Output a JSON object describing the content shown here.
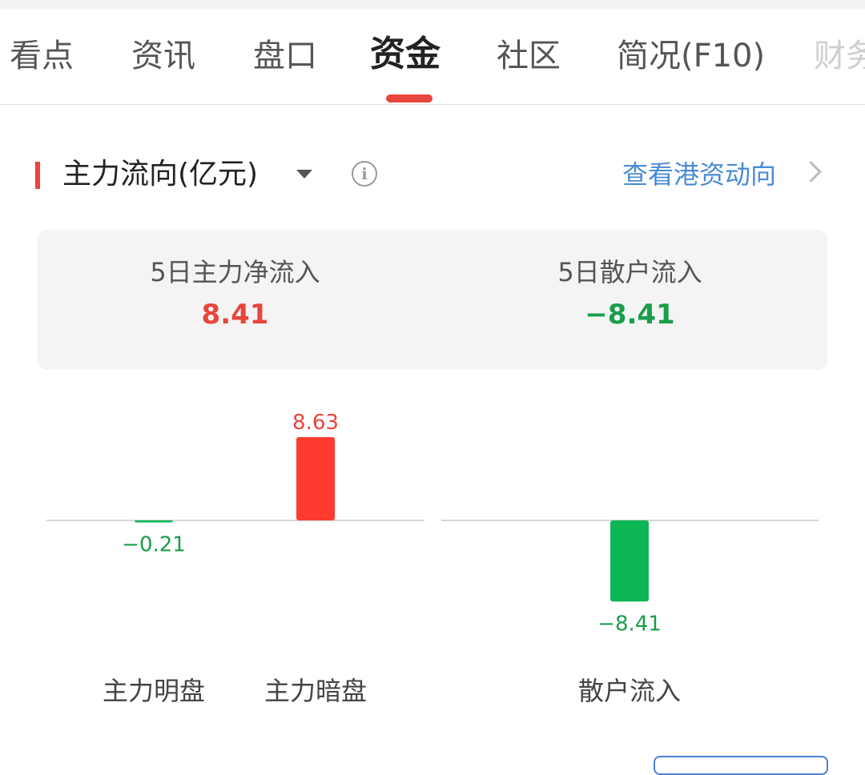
{
  "tabs": [
    {
      "label": "看点"
    },
    {
      "label": "资讯"
    },
    {
      "label": "盘口"
    },
    {
      "label": "资金"
    },
    {
      "label": "社区"
    },
    {
      "label": "简况(F10)"
    },
    {
      "label": "财务"
    }
  ],
  "active_tab": "资金",
  "section": {
    "title": "主力流向(亿元)",
    "link": "查看港资动向",
    "info_glyph": "i"
  },
  "summary": {
    "main_net": {
      "label": "5日主力净流入",
      "value": "8.41"
    },
    "retail": {
      "label": "5日散户流入",
      "value": "−8.41"
    }
  },
  "colors": {
    "up": "#e8453c",
    "bar_up": "#ff3b30",
    "down": "#1a9e4b",
    "bar_down": "#0db655",
    "link": "#4a8bd4"
  },
  "chart_data": {
    "type": "bar",
    "categories": [
      "主力明盘",
      "主力暗盘",
      "散户流入"
    ],
    "values": [
      -0.21,
      8.63,
      -8.41
    ],
    "value_labels": [
      "−0.21",
      "8.63",
      "−8.41"
    ],
    "unit": "亿元",
    "grid": false
  }
}
